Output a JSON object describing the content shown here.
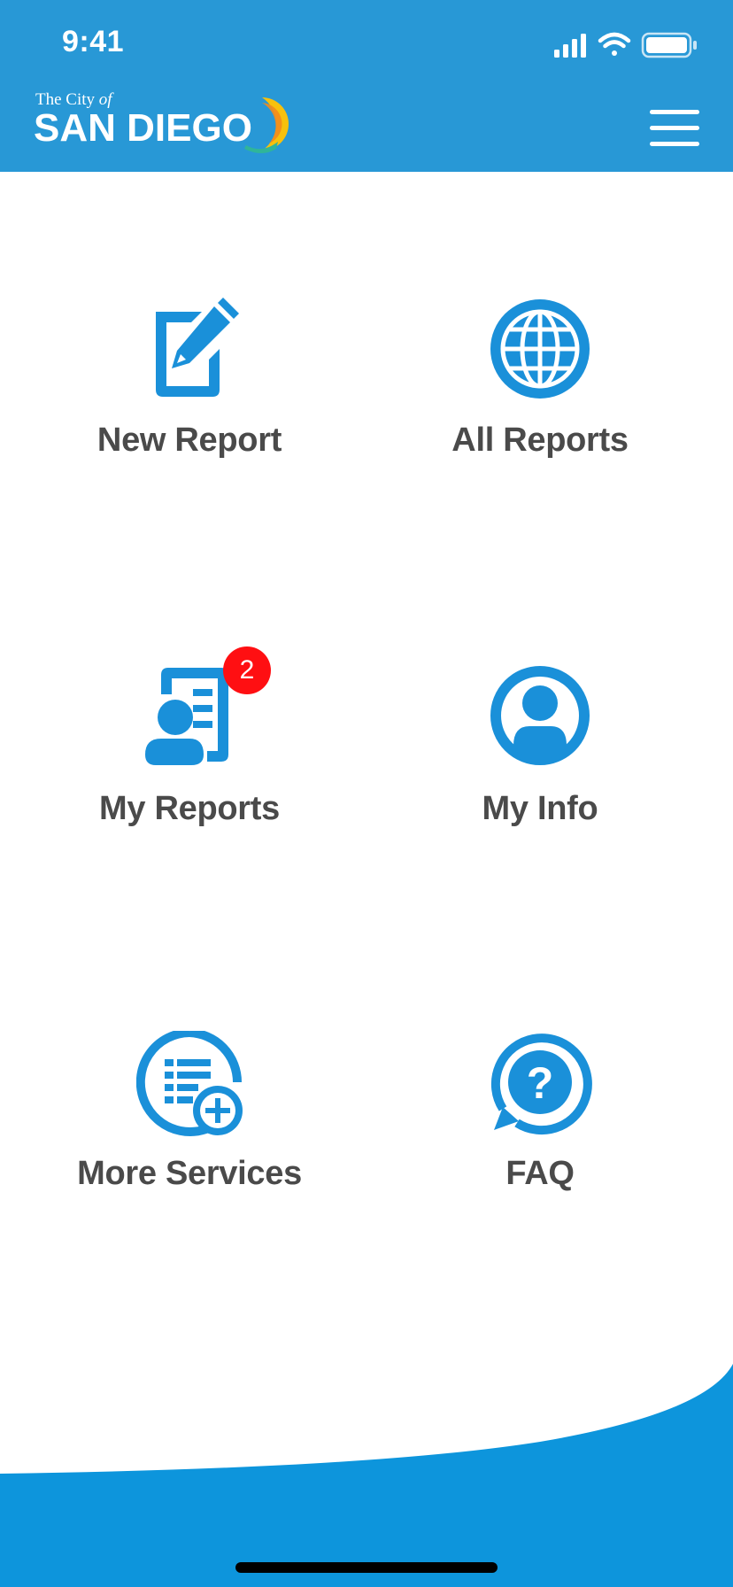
{
  "status_bar": {
    "time": "9:41",
    "icons": [
      "signal-icon",
      "wifi-icon",
      "battery-icon"
    ]
  },
  "header": {
    "logo_line1_prefix": "The City ",
    "logo_line1_italic": "of",
    "logo_line2": "SAN DIEGO",
    "menu_icon": "hamburger-menu-icon"
  },
  "grid": {
    "items": [
      {
        "label": "New Report",
        "icon": "edit-document-icon"
      },
      {
        "label": "All Reports",
        "icon": "globe-icon"
      },
      {
        "label": "My Reports",
        "icon": "user-report-icon",
        "badge": "2"
      },
      {
        "label": "My Info",
        "icon": "user-circle-icon"
      },
      {
        "label": "More Services",
        "icon": "list-add-icon"
      },
      {
        "label": "FAQ",
        "icon": "question-circle-icon"
      }
    ]
  },
  "colors": {
    "brand_blue": "#2898d6",
    "icon_blue": "#1a90d9",
    "label_gray": "#4a4a4a",
    "badge_red": "#ff0f12",
    "footer_blue": "#0d95dc"
  }
}
